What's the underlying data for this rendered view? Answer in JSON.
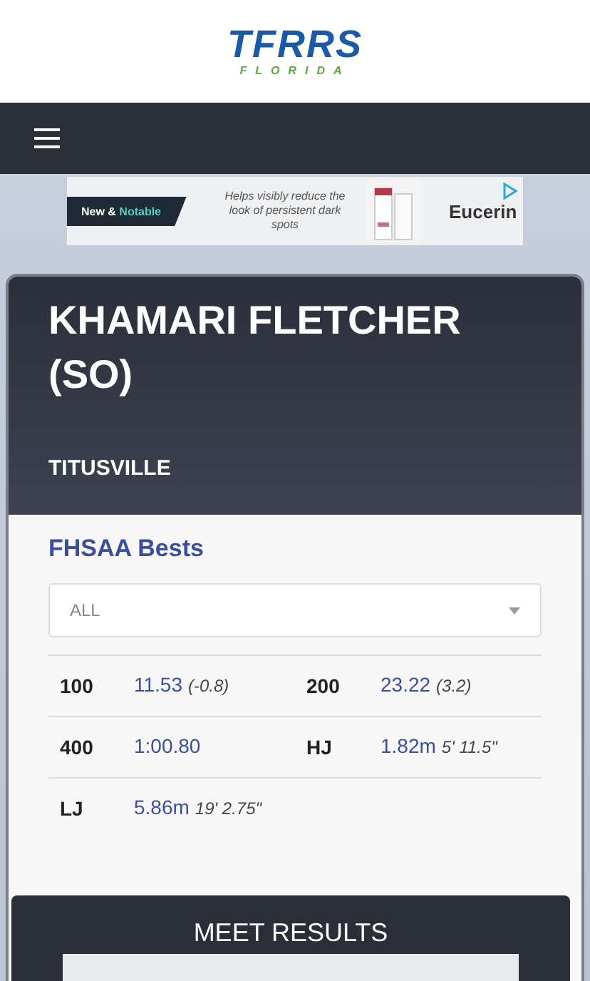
{
  "logo": {
    "wordmark": "TFRRS",
    "region": "FLORIDA"
  },
  "ad": {
    "tag_plain": "New & ",
    "tag_accent": "Notable",
    "copy": "Helps visibly reduce the look of persistent dark spots",
    "brand": "Eucerin"
  },
  "athlete": {
    "name": "KHAMARI FLETCHER (SO)",
    "school": "TITUSVILLE"
  },
  "bests": {
    "title": "FHSAA Bests",
    "filter": {
      "value": "ALL"
    },
    "rows": [
      [
        {
          "event": "100",
          "mark": "11.53",
          "note": "(-0.8)"
        },
        {
          "event": "200",
          "mark": "23.22",
          "note": "(3.2)"
        }
      ],
      [
        {
          "event": "400",
          "mark": "1:00.80"
        },
        {
          "event": "HJ",
          "mark": "1.82m",
          "note": "5' 11.5\""
        }
      ],
      [
        {
          "event": "LJ",
          "mark": "5.86m",
          "note": "19' 2.75\""
        }
      ]
    ]
  },
  "meet_results": {
    "title": "MEET RESULTS"
  }
}
